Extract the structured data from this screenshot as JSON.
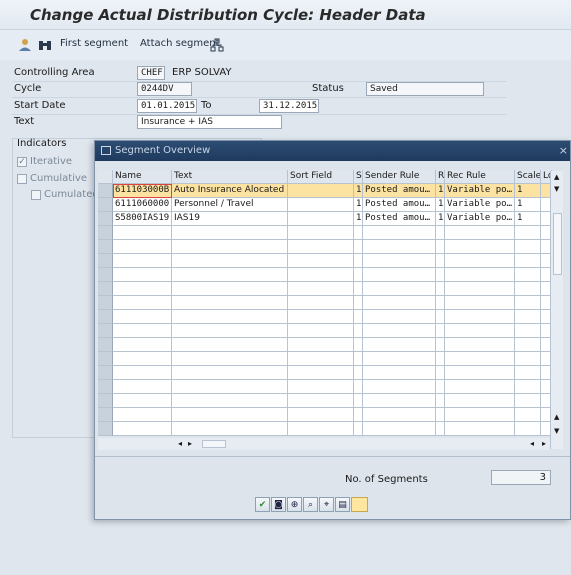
{
  "window": {
    "title": "Change Actual Distribution Cycle: Header Data"
  },
  "toolbar": {
    "first_segment_label": "First segment",
    "attach_segment_label": "Attach segment"
  },
  "header": {
    "controlling_area_label": "Controlling Area",
    "controlling_area_value": "CHEF",
    "controlling_area_text": "ERP SOLVAY",
    "cycle_label": "Cycle",
    "cycle_value": "0244DV",
    "status_label": "Status",
    "status_value": "Saved",
    "start_date_label": "Start Date",
    "start_date_value": "01.01.2015",
    "to_label": "To",
    "end_date_value": "31.12.2015",
    "text_label": "Text",
    "text_value": "Insurance + IAS"
  },
  "indicators": {
    "title": "Indicators",
    "iterative_label": "Iterative",
    "cumulative_label": "Cumulative",
    "cumulated_label": "Cumulated"
  },
  "popup": {
    "title": "Segment Overview",
    "close_icon": "close-icon",
    "columns": [
      "Name",
      "Text",
      "Sort Field",
      "S",
      "Sender Rule",
      "R",
      "Rec Rule",
      "Scale",
      "Lo"
    ],
    "rows": [
      [
        "611103000B",
        "Auto Insurance Alocated",
        "",
        "1",
        "Posted amou…",
        "1",
        "Variable po…",
        "1",
        ""
      ],
      [
        "6111060000",
        "Personnel / Travel",
        "",
        "1",
        "Posted amou…",
        "1",
        "Variable po…",
        "1",
        ""
      ],
      [
        "S5800IAS19",
        "IAS19",
        "",
        "1",
        "Posted amou…",
        "1",
        "Variable po…",
        "1",
        ""
      ]
    ],
    "selected_row": 0,
    "no_segments_label": "No. of Segments",
    "no_segments_value": "3"
  }
}
